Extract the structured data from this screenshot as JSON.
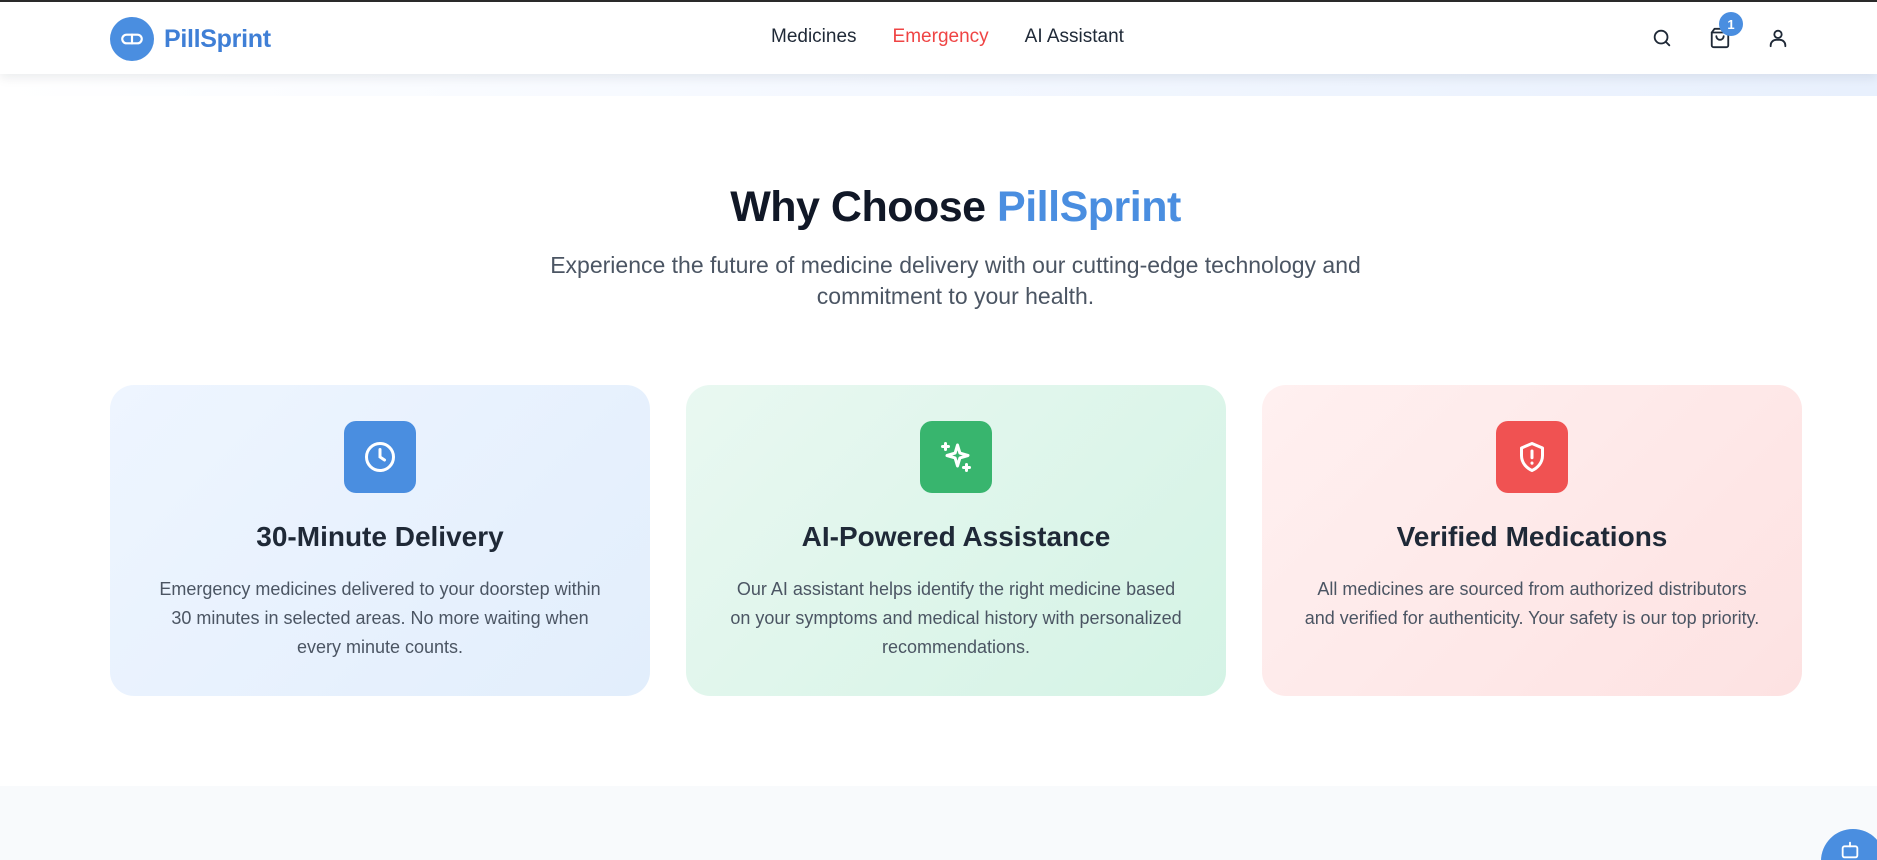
{
  "brand": {
    "name": "PillSprint",
    "logo_icon": "pill-icon",
    "color": "#4a8ee0"
  },
  "nav": {
    "items": [
      {
        "label": "Medicines"
      },
      {
        "label": "Emergency",
        "color": "#ef4444"
      },
      {
        "label": "AI Assistant"
      }
    ]
  },
  "header_actions": {
    "search_icon": "search-icon",
    "cart_icon": "shopping-bag-icon",
    "cart_count": "1",
    "account_icon": "user-icon"
  },
  "features": {
    "title_prefix": "Why Choose ",
    "title_accent": "PillSprint",
    "subtitle": "Experience the future of medicine delivery with our cutting-edge technology and commitment to your health.",
    "cards": [
      {
        "icon": "clock-icon",
        "accent": "#4a8ee0",
        "title": "30-Minute Delivery",
        "description": "Emergency medicines delivered to your doorstep within 30 minutes in selected areas. No more waiting when every minute counts."
      },
      {
        "icon": "sparkles-icon",
        "accent": "#38b56e",
        "title": "AI-Powered Assistance",
        "description": "Our AI assistant helps identify the right medicine based on your symptoms and medical history with personalized recommendations."
      },
      {
        "icon": "shield-alert-icon",
        "accent": "#f05252",
        "title": "Verified Medications",
        "description": "All medicines are sourced from authorized distributors and verified for authenticity. Your safety is our top priority."
      }
    ]
  },
  "floating_button": {
    "icon": "chat-bot-icon"
  }
}
